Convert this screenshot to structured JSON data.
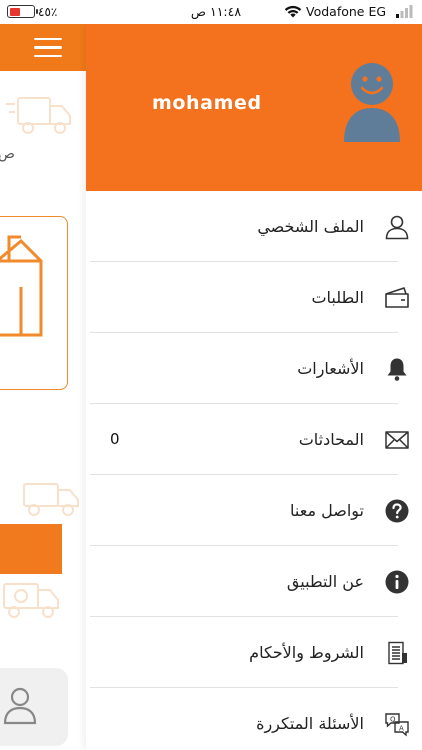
{
  "status_bar": {
    "carrier": "Vodafone EG",
    "time": "١١:٤٨ ص",
    "battery_percent": "٤٥٪",
    "battery_level": 0.45,
    "battery_color": "#e8342b"
  },
  "background": {
    "header_color": "#f07a1a",
    "icons": [
      "hamburger-menu-icon",
      "truck-icon",
      "box-icon",
      "user-icon"
    ]
  },
  "drawer": {
    "header_color": "#f4721d",
    "username": "mohamed",
    "avatar_icon": "smiley-avatar-icon",
    "menu": [
      {
        "label": "الملف الشخصي",
        "icon": "user-icon"
      },
      {
        "label": "الطلبات",
        "icon": "orders-icon"
      },
      {
        "label": "الأشعارات",
        "icon": "bell-icon"
      },
      {
        "label": "المحادثات",
        "icon": "mail-icon",
        "count": "0"
      },
      {
        "label": "تواصل معنا",
        "icon": "question-icon"
      },
      {
        "label": "عن التطبيق",
        "icon": "info-icon"
      },
      {
        "label": "الشروط والأحكام",
        "icon": "terms-icon"
      },
      {
        "label": "الأسئلة المتكررة",
        "icon": "faq-icon"
      }
    ]
  }
}
